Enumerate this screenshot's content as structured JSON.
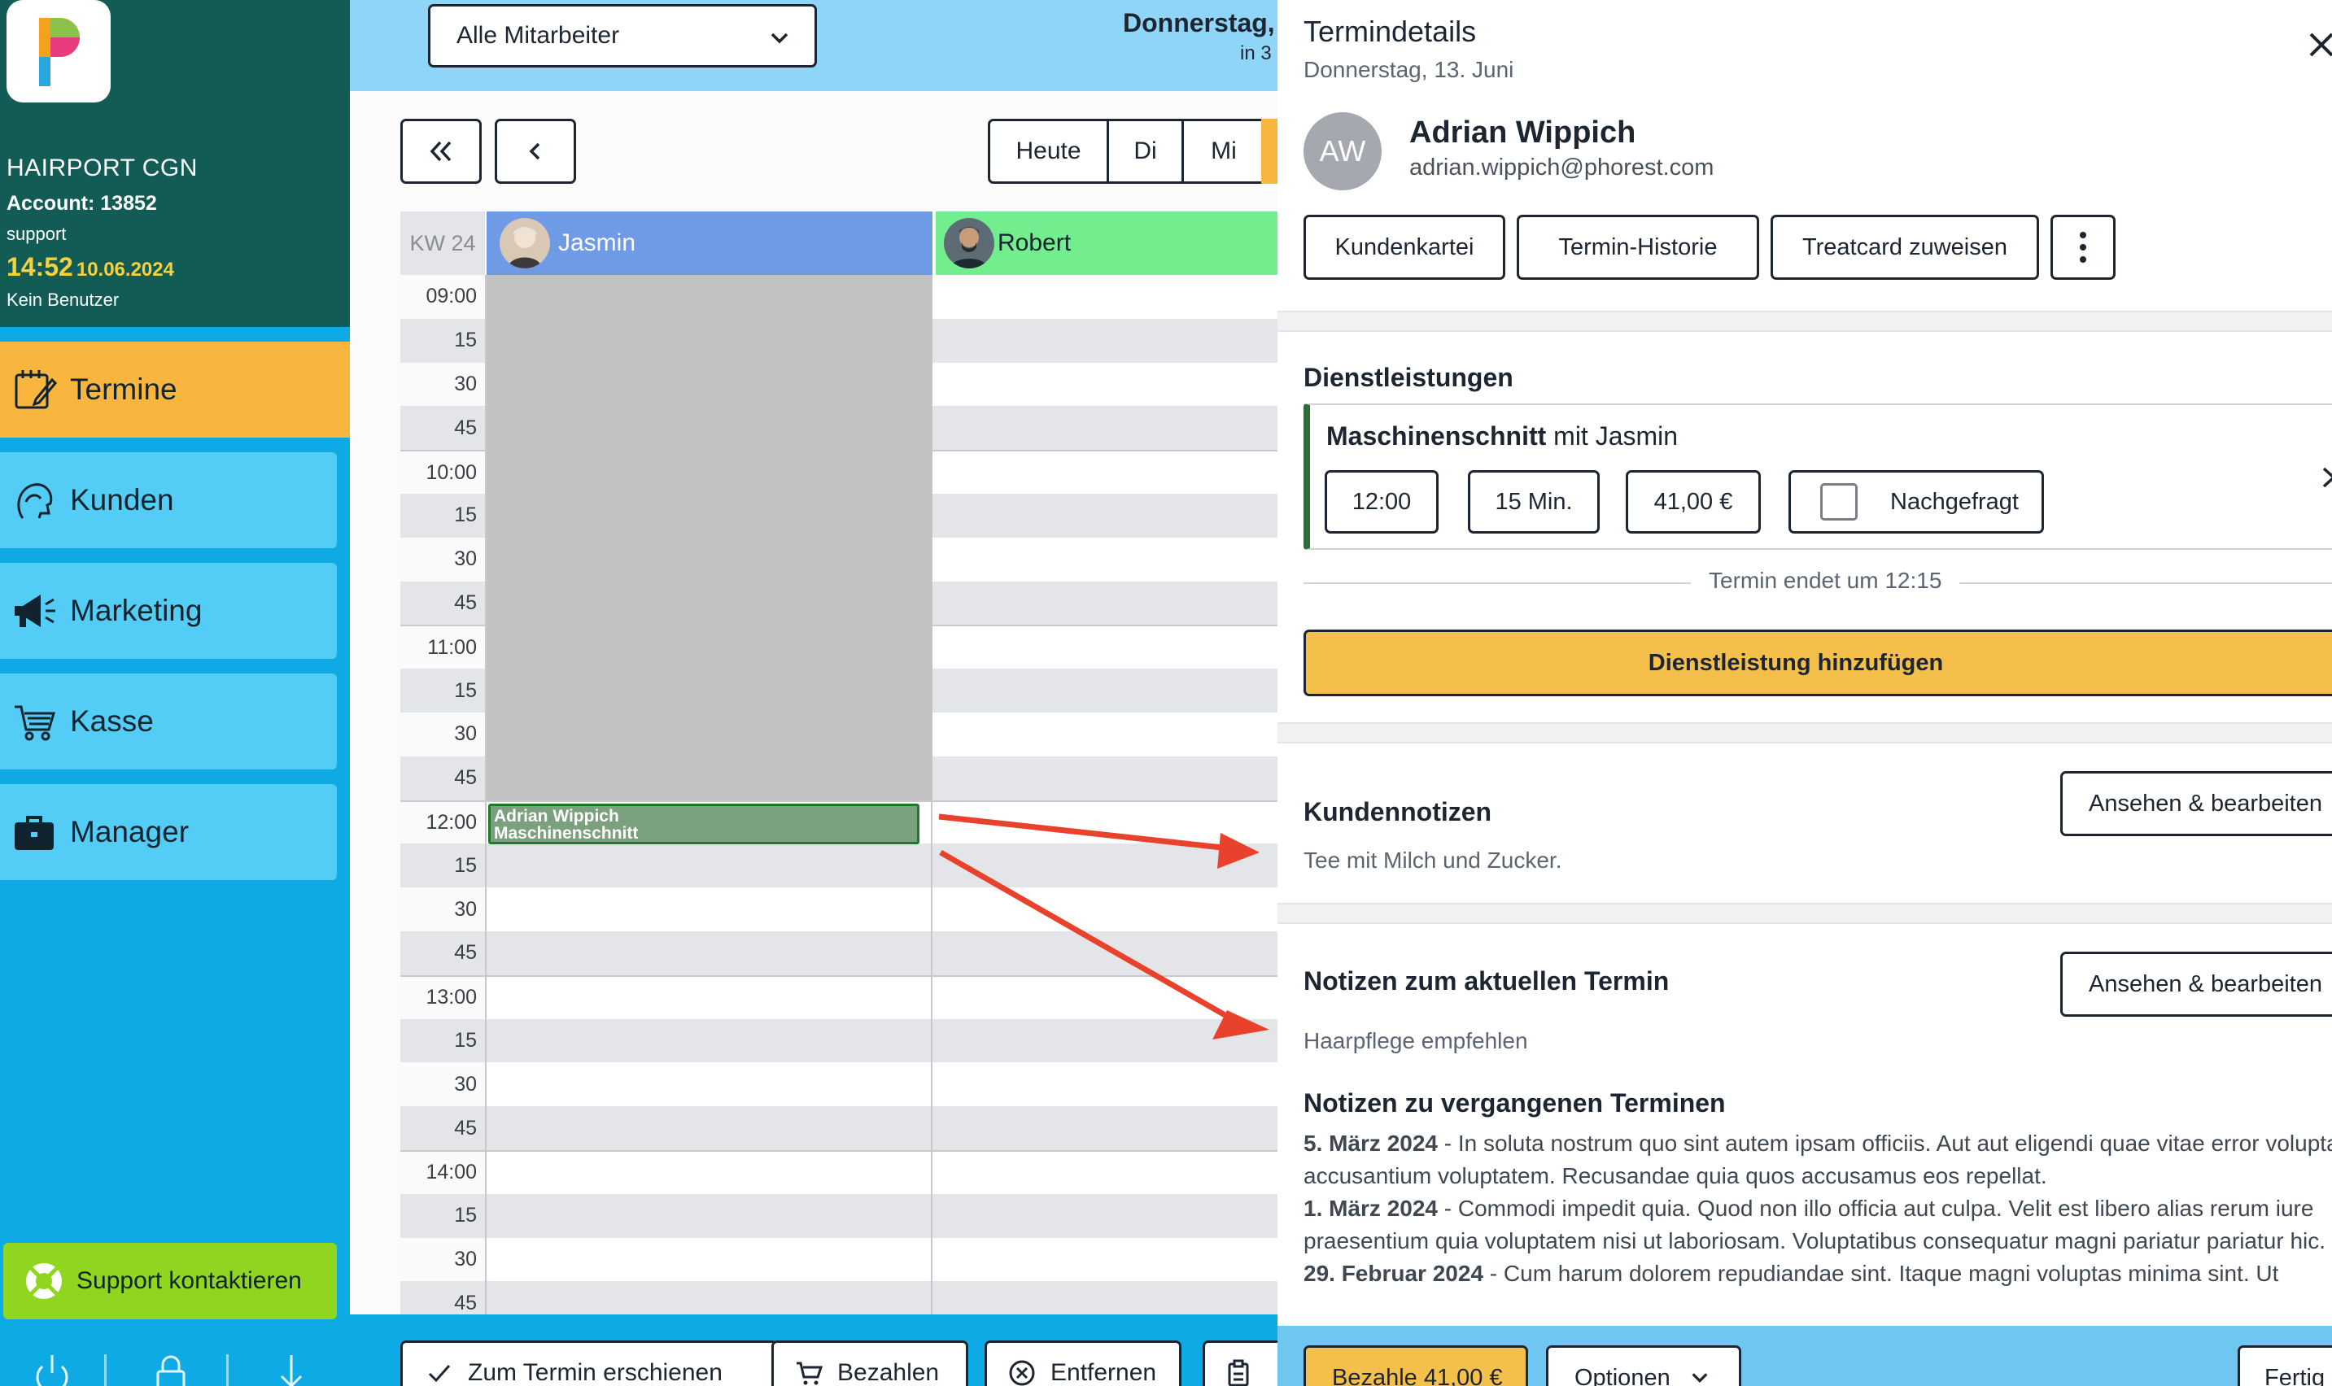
{
  "sidebar": {
    "salon_name": "HAIRPORT CGN",
    "account": "Account: 13852",
    "role": "support",
    "time": "14:52",
    "date": "10.06.2024",
    "user": "Kein Benutzer",
    "nav": [
      {
        "label": "Termine",
        "icon": "calendar-edit-icon",
        "active": true
      },
      {
        "label": "Kunden",
        "icon": "customer-head-icon",
        "active": false
      },
      {
        "label": "Marketing",
        "icon": "megaphone-icon",
        "active": false
      },
      {
        "label": "Kasse",
        "icon": "cart-icon",
        "active": false
      },
      {
        "label": "Manager",
        "icon": "briefcase-icon",
        "active": false
      }
    ],
    "support_label": "Support kontaktieren"
  },
  "calendar": {
    "staff_select": "Alle Mitarbeiter",
    "date_heading": "Donnerstag,",
    "date_sub": "in 3",
    "view_buttons": [
      "Heute",
      "Di",
      "Mi"
    ],
    "week": "KW 24",
    "columns": [
      {
        "name": "Jasmin",
        "color": "#6f9ae6"
      },
      {
        "name": "Robert",
        "color": "#72ee8e"
      }
    ],
    "times": [
      "09:00",
      "15",
      "30",
      "45",
      "10:00",
      "15",
      "30",
      "45",
      "11:00",
      "15",
      "30",
      "45",
      "12:00",
      "15",
      "30",
      "45",
      "13:00",
      "15",
      "30",
      "45",
      "14:00",
      "15",
      "30",
      "45"
    ],
    "appointment": {
      "client": "Adrian Wippich",
      "service": "Maschinenschnitt"
    },
    "bottom_buttons": [
      {
        "label": "Zum Termin erschienen",
        "icon": "check-icon"
      },
      {
        "label": "Bezahlen",
        "icon": "cart-icon"
      },
      {
        "label": "Entfernen",
        "icon": "remove-circle-icon"
      },
      {
        "label": "",
        "icon": "clipboard-icon"
      }
    ]
  },
  "details": {
    "title": "Termindetails",
    "date": "Donnerstag, 13. Juni",
    "client_initials": "AW",
    "client_name": "Adrian Wippich",
    "client_email": "adrian.wippich@phorest.com",
    "actions": [
      "Kundenkartei",
      "Termin-Historie",
      "Treatcard zuweisen"
    ],
    "services_title": "Dienstleistungen",
    "service": {
      "name": "Maschinenschnitt",
      "with": "mit Jasmin",
      "time": "12:00",
      "duration": "15 Min.",
      "price": "41,00 €",
      "requested_label": "Nachgefragt"
    },
    "ends_text": "Termin endet um 12:15",
    "add_service": "Dienstleistung hinzufügen",
    "client_notes_title": "Kundennotizen",
    "client_notes_text": "Tee mit Milch und Zucker.",
    "edit_label": "Ansehen & bearbeiten",
    "appt_notes_title": "Notizen zum aktuellen Termin",
    "appt_notes_text": "Haarpflege empfehlen",
    "past_title": "Notizen zu vergangenen Terminen",
    "past_notes": [
      {
        "date": "5. März 2024",
        "text": " - In soluta nostrum quo sint autem ipsam officiis. Aut aut eligendi quae vitae error voluptate accusantium voluptatem. Recusandae quia quos accusamus eos repellat."
      },
      {
        "date": "1. März 2024",
        "text": " - Commodi impedit quia. Quod non illo officia aut culpa. Velit est libero alias rerum iure praesentium quia voluptatem nisi ut laboriosam. Voluptatibus consequatur magni pariatur pariatur hic."
      },
      {
        "date": "29. Februar 2024",
        "text": " - Cum harum dolorem repudiandae sint. Itaque magni voluptas minima sint. Ut"
      }
    ],
    "footer": {
      "pay": "Bezahle 41,00 €",
      "options": "Optionen",
      "done": "Fertig"
    }
  },
  "colors": {
    "sidebar_top": "#125c55",
    "sidebar_bg": "#0eaae6",
    "nav_active": "#f9b63f",
    "nav_item": "#54cdf6",
    "support": "#90d51f",
    "accent_yellow": "#f4c04b",
    "arrow_red": "#e8412c"
  }
}
